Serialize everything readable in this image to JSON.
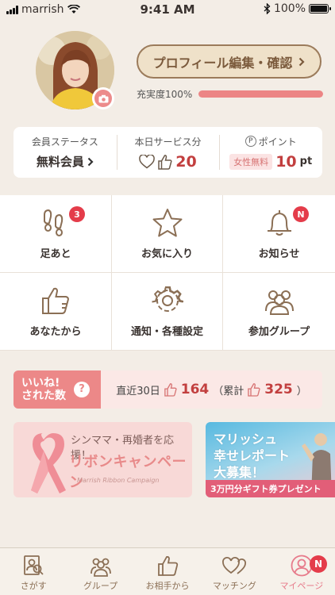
{
  "status_bar": {
    "carrier": "marrish",
    "time": "9:41 AM",
    "battery": "100%"
  },
  "profile": {
    "edit_label": "プロフィール編集・確認",
    "completion_label": "充実度100%",
    "completion_fraction": 1.0
  },
  "summary": {
    "member_status_label": "会員ステータス",
    "member_status_value": "無料会員",
    "service_label": "本日サービス分",
    "service_value": "20",
    "point_label": "ポイント",
    "point_symbol": "P",
    "female_free": "女性無料",
    "point_value": "10",
    "point_unit": "pt"
  },
  "menu": {
    "footprints": {
      "label": "足あと",
      "badge": "3"
    },
    "favorites": {
      "label": "お気に入り"
    },
    "notices": {
      "label": "お知らせ",
      "badge": "N"
    },
    "from_you": {
      "label": "あなたから"
    },
    "settings": {
      "label": "通知・各種設定"
    },
    "groups": {
      "label": "参加グループ"
    }
  },
  "likes": {
    "tag_line1": "いいね!",
    "tag_line2": "された数",
    "help": "?",
    "recent_label": "直近30日",
    "recent_value": "164",
    "total_open": "（累計",
    "total_value": "325",
    "total_close": "）"
  },
  "banners": {
    "ribbon_line1": "シンママ・再婚者を応援！",
    "ribbon_line2": "リボンキャンペーン",
    "ribbon_line3": "Marrish Ribbon Campaign",
    "report_line1": "マリッシュ",
    "report_line2": "幸せレポート",
    "report_line3": "大募集！",
    "report_foot": "3万円分ギフト券プレゼント"
  },
  "tabbar": {
    "search": "さがす",
    "group": "グループ",
    "from_partner": "お相手から",
    "matching": "マッチング",
    "mypage": "マイページ",
    "mypage_badge": "N"
  },
  "colors": {
    "accent": "#ec8585",
    "brown": "#9b7b5b",
    "badge_red": "#e43c4a",
    "background": "#f3ede6"
  }
}
